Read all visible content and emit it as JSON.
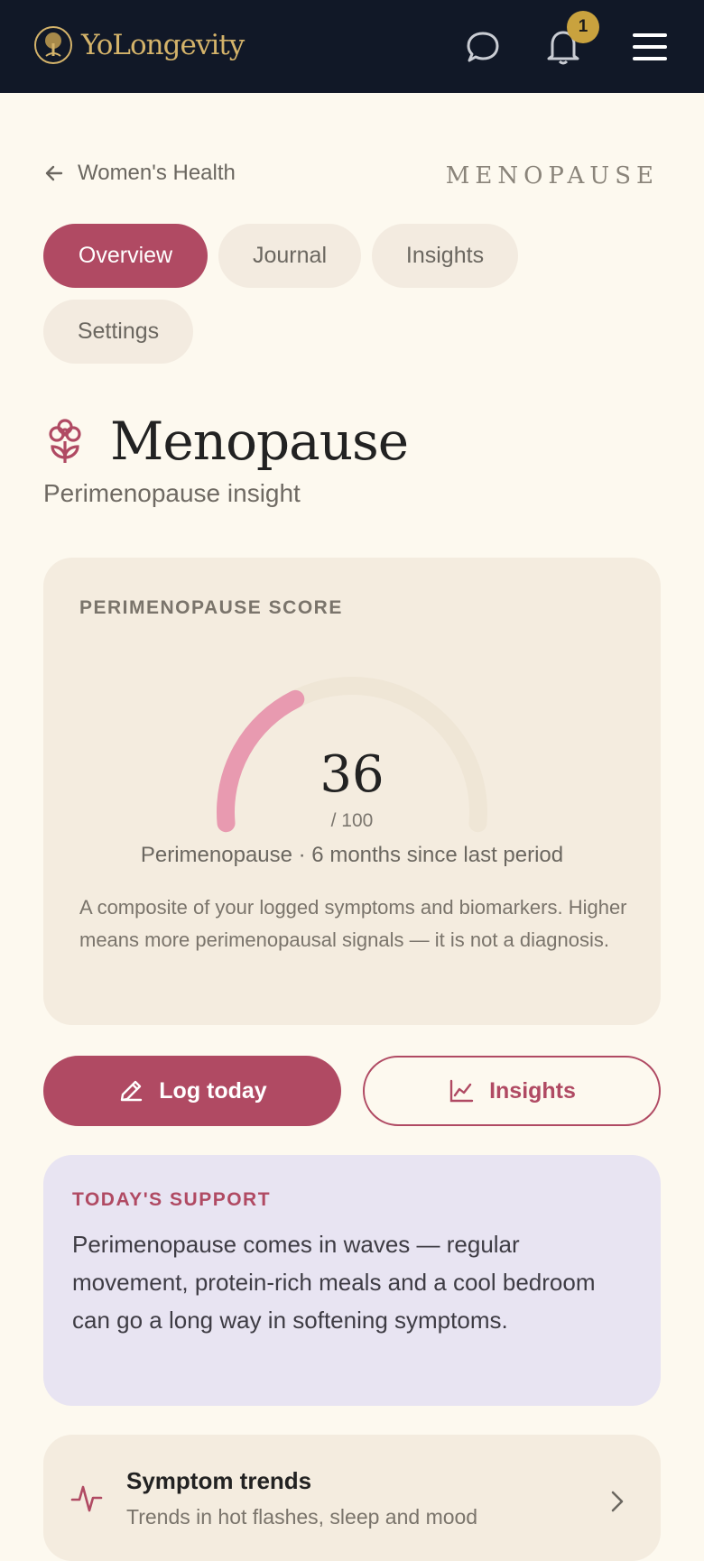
{
  "header": {
    "brand": "YoLongevity",
    "notification_count": "1"
  },
  "breadcrumb": {
    "back_label": "Women's Health",
    "section_label": "MENOPAUSE"
  },
  "tabs": [
    {
      "label": "Overview",
      "active": true
    },
    {
      "label": "Journal",
      "active": false
    },
    {
      "label": "Insights",
      "active": false
    },
    {
      "label": "Settings",
      "active": false
    }
  ],
  "page": {
    "title": "Menopause",
    "subtitle": "Perimenopause insight"
  },
  "score_card": {
    "label": "PERIMENOPAUSE SCORE",
    "score": 36,
    "score_display": "36",
    "max_label": "/ 100",
    "status": "Perimenopause · 6 months since last period",
    "description": "A composite of your logged symptoms and biomarkers. Higher means more perimenopausal signals — it is not a diagnosis."
  },
  "actions": {
    "log_label": "Log today",
    "insights_label": "Insights"
  },
  "support": {
    "label": "TODAY'S SUPPORT",
    "text": "Perimenopause comes in waves — regular movement, protein-rich meals and a cool bedroom can go a long way in softening symptoms."
  },
  "trend_card": {
    "title": "Symptom trends",
    "subtitle": "Trends in hot flashes, sleep and mood"
  },
  "colors": {
    "accent": "#b04a63",
    "header_bg": "#111827",
    "gold": "#c9a23e",
    "gauge_fill": "#e89ab0",
    "gauge_track": "#efe6d6"
  }
}
